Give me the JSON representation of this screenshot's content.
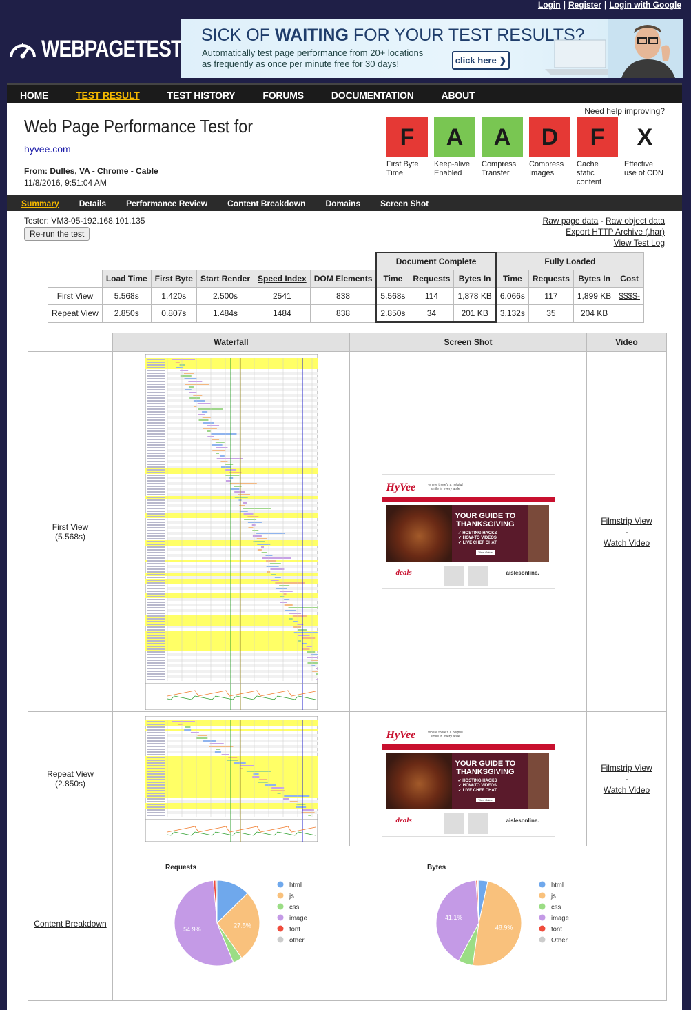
{
  "top_links": {
    "login": "Login",
    "register": "Register",
    "login_google": "Login with Google"
  },
  "logo": {
    "text": "WEBPAGETEST"
  },
  "banner": {
    "headline_pre": "SICK OF ",
    "headline_bold": "WAITING",
    "headline_post": " FOR YOUR TEST RESULTS?",
    "sub_line1": "Automatically test page performance from 20+ locations",
    "sub_line2": "as frequently as once per minute free for 30 days!",
    "cta": "click here"
  },
  "nav": [
    {
      "label": "HOME",
      "active": false
    },
    {
      "label": "TEST RESULT",
      "active": true
    },
    {
      "label": "TEST HISTORY",
      "active": false
    },
    {
      "label": "FORUMS",
      "active": false
    },
    {
      "label": "DOCUMENTATION",
      "active": false
    },
    {
      "label": "ABOUT",
      "active": false
    }
  ],
  "help_link": "Need help improving?",
  "page_title": "Web Page Performance Test for",
  "test_url": "hyvee.com",
  "from_label": "From:",
  "from_value": "Dulles, VA - Chrome - Cable",
  "date": "11/8/2016, 9:51:04 AM",
  "grades": [
    {
      "letter": "F",
      "label": "First Byte Time",
      "color": "#e53935"
    },
    {
      "letter": "A",
      "label": "Keep-alive Enabled",
      "color": "#79c652"
    },
    {
      "letter": "A",
      "label": "Compress Transfer",
      "color": "#79c652"
    },
    {
      "letter": "D",
      "label": "Compress Images",
      "color": "#e53935"
    },
    {
      "letter": "F",
      "label": "Cache static content",
      "color": "#e53935"
    },
    {
      "letter": "X",
      "label": "Effective use of CDN",
      "color": "#ffffff"
    }
  ],
  "subnav": [
    {
      "label": "Summary",
      "active": true
    },
    {
      "label": "Details",
      "active": false
    },
    {
      "label": "Performance Review",
      "active": false
    },
    {
      "label": "Content Breakdown",
      "active": false
    },
    {
      "label": "Domains",
      "active": false
    },
    {
      "label": "Screen Shot",
      "active": false
    }
  ],
  "tester": "Tester: VM3-05-192.168.101.135",
  "rerun": "Re-run the test",
  "raw_links": {
    "raw_page": "Raw page data",
    "dash": " - ",
    "raw_object": "Raw object data",
    "export": "Export HTTP Archive (.har)",
    "log": "View Test Log"
  },
  "results": {
    "group_doc": "Document Complete",
    "group_full": "Fully Loaded",
    "headers": [
      "Load Time",
      "First Byte",
      "Start Render",
      "Speed Index",
      "DOM Elements",
      "Time",
      "Requests",
      "Bytes In",
      "Time",
      "Requests",
      "Bytes In",
      "Cost"
    ],
    "rows": [
      {
        "label": "First View",
        "cells": [
          "5.568s",
          "1.420s",
          "2.500s",
          "2541",
          "838",
          "5.568s",
          "114",
          "1,878 KB",
          "6.066s",
          "117",
          "1,899 KB",
          "$$$$-"
        ]
      },
      {
        "label": "Repeat View",
        "cells": [
          "2.850s",
          "0.807s",
          "1.484s",
          "1484",
          "838",
          "2.850s",
          "34",
          "201 KB",
          "3.132s",
          "35",
          "204 KB",
          ""
        ]
      }
    ]
  },
  "media": {
    "col_waterfall": "Waterfall",
    "col_screenshot": "Screen Shot",
    "col_video": "Video",
    "first_view_label": "First View",
    "first_view_time": "(5.568s)",
    "repeat_view_label": "Repeat View",
    "repeat_view_time": "(2.850s)",
    "filmstrip": "Filmstrip View",
    "dash": "-",
    "watch_video": "Watch Video",
    "content_breakdown": "Content Breakdown"
  },
  "screenshot": {
    "brand": "HyVee",
    "tagline": "where there's a helpful smile in every aisle",
    "hero_line1": "YOUR GUIDE TO",
    "hero_line2": "THANKSGIVING",
    "hero_items": [
      "✓ HOSTING HACKS",
      "✓ HOW-TO VIDEOS",
      "✓ LIVE CHEF CHAT"
    ],
    "hero_button": "View Guide",
    "deals": "deals",
    "aisles": "aislesonline."
  },
  "charts_meta": {
    "requests_title": "Requests",
    "bytes_title": "Bytes",
    "colors": {
      "html": "#6fa8ec",
      "js": "#f9c17c",
      "css": "#9bdd85",
      "image": "#c49ae6",
      "font": "#ef4c3c",
      "other": "#cccccc"
    }
  },
  "chart_data": [
    {
      "type": "pie",
      "title": "Requests",
      "labels": [
        "html",
        "js",
        "css",
        "image",
        "font",
        "other"
      ],
      "values": [
        12.7,
        27.5,
        3.5,
        54.9,
        0.9,
        0.5
      ],
      "data_labels": [
        "",
        "27.5%",
        "",
        "54.9%",
        "",
        ""
      ]
    },
    {
      "type": "pie",
      "title": "Bytes",
      "labels": [
        "html",
        "js",
        "css",
        "image",
        "font",
        "Other"
      ],
      "values": [
        3.4,
        48.9,
        5.5,
        41.1,
        0.7,
        0.4
      ],
      "data_labels": [
        "",
        "48.9%",
        "",
        "41.1%",
        "",
        ""
      ]
    }
  ]
}
